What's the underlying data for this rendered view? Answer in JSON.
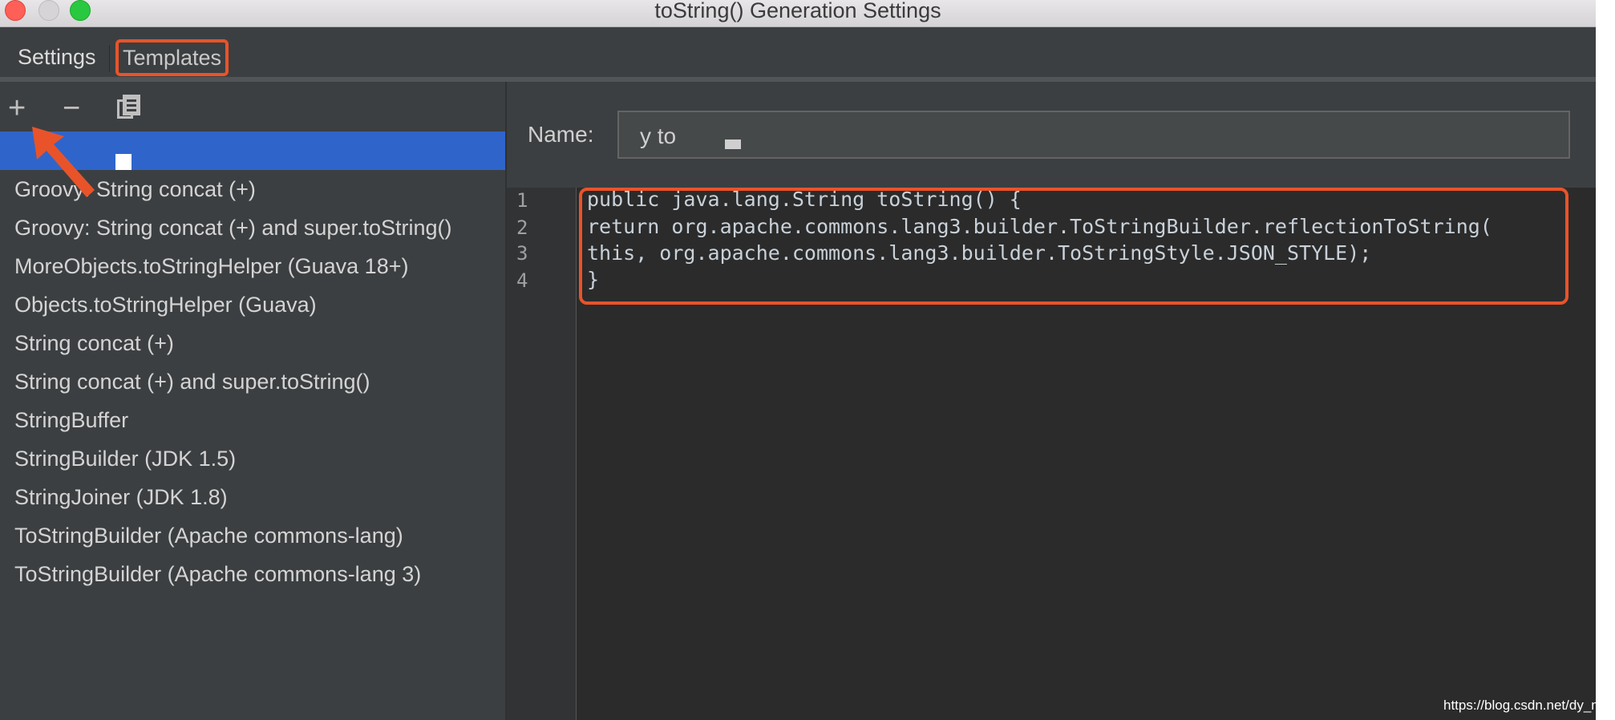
{
  "window": {
    "title": "toString() Generation Settings"
  },
  "tabs": [
    {
      "label": "Settings",
      "active": false
    },
    {
      "label": "Templates",
      "active": true
    }
  ],
  "toolbar": {
    "add_icon": "+",
    "remove_icon": "−",
    "copy_icon": "copy-icon"
  },
  "templates": [
    {
      "label": "",
      "selected": true
    },
    {
      "label": "Groovy: String concat (+)"
    },
    {
      "label": "Groovy: String concat (+) and super.toString()"
    },
    {
      "label": "MoreObjects.toStringHelper (Guava 18+)"
    },
    {
      "label": "Objects.toStringHelper (Guava)"
    },
    {
      "label": "String concat (+)"
    },
    {
      "label": "String concat (+) and super.toString()"
    },
    {
      "label": "StringBuffer"
    },
    {
      "label": "StringBuilder (JDK 1.5)"
    },
    {
      "label": "StringJoiner (JDK 1.8)"
    },
    {
      "label": "ToStringBuilder (Apache commons-lang)"
    },
    {
      "label": "ToStringBuilder (Apache commons-lang 3)"
    }
  ],
  "editor": {
    "name_label": "Name:",
    "name_value": "y to",
    "line_numbers": [
      "1",
      "2",
      "3",
      "4"
    ],
    "code_lines": [
      "public java.lang.String toString() {",
      "return org.apache.commons.lang3.builder.ToStringBuilder.reflectionToString(",
      "this, org.apache.commons.lang3.builder.ToStringStyle.JSON_STYLE);",
      "}"
    ]
  },
  "watermark": "https://blog.csdn.net/dy_mac",
  "colors": {
    "annotation": "#e9532a",
    "selection": "#2f65ca"
  }
}
